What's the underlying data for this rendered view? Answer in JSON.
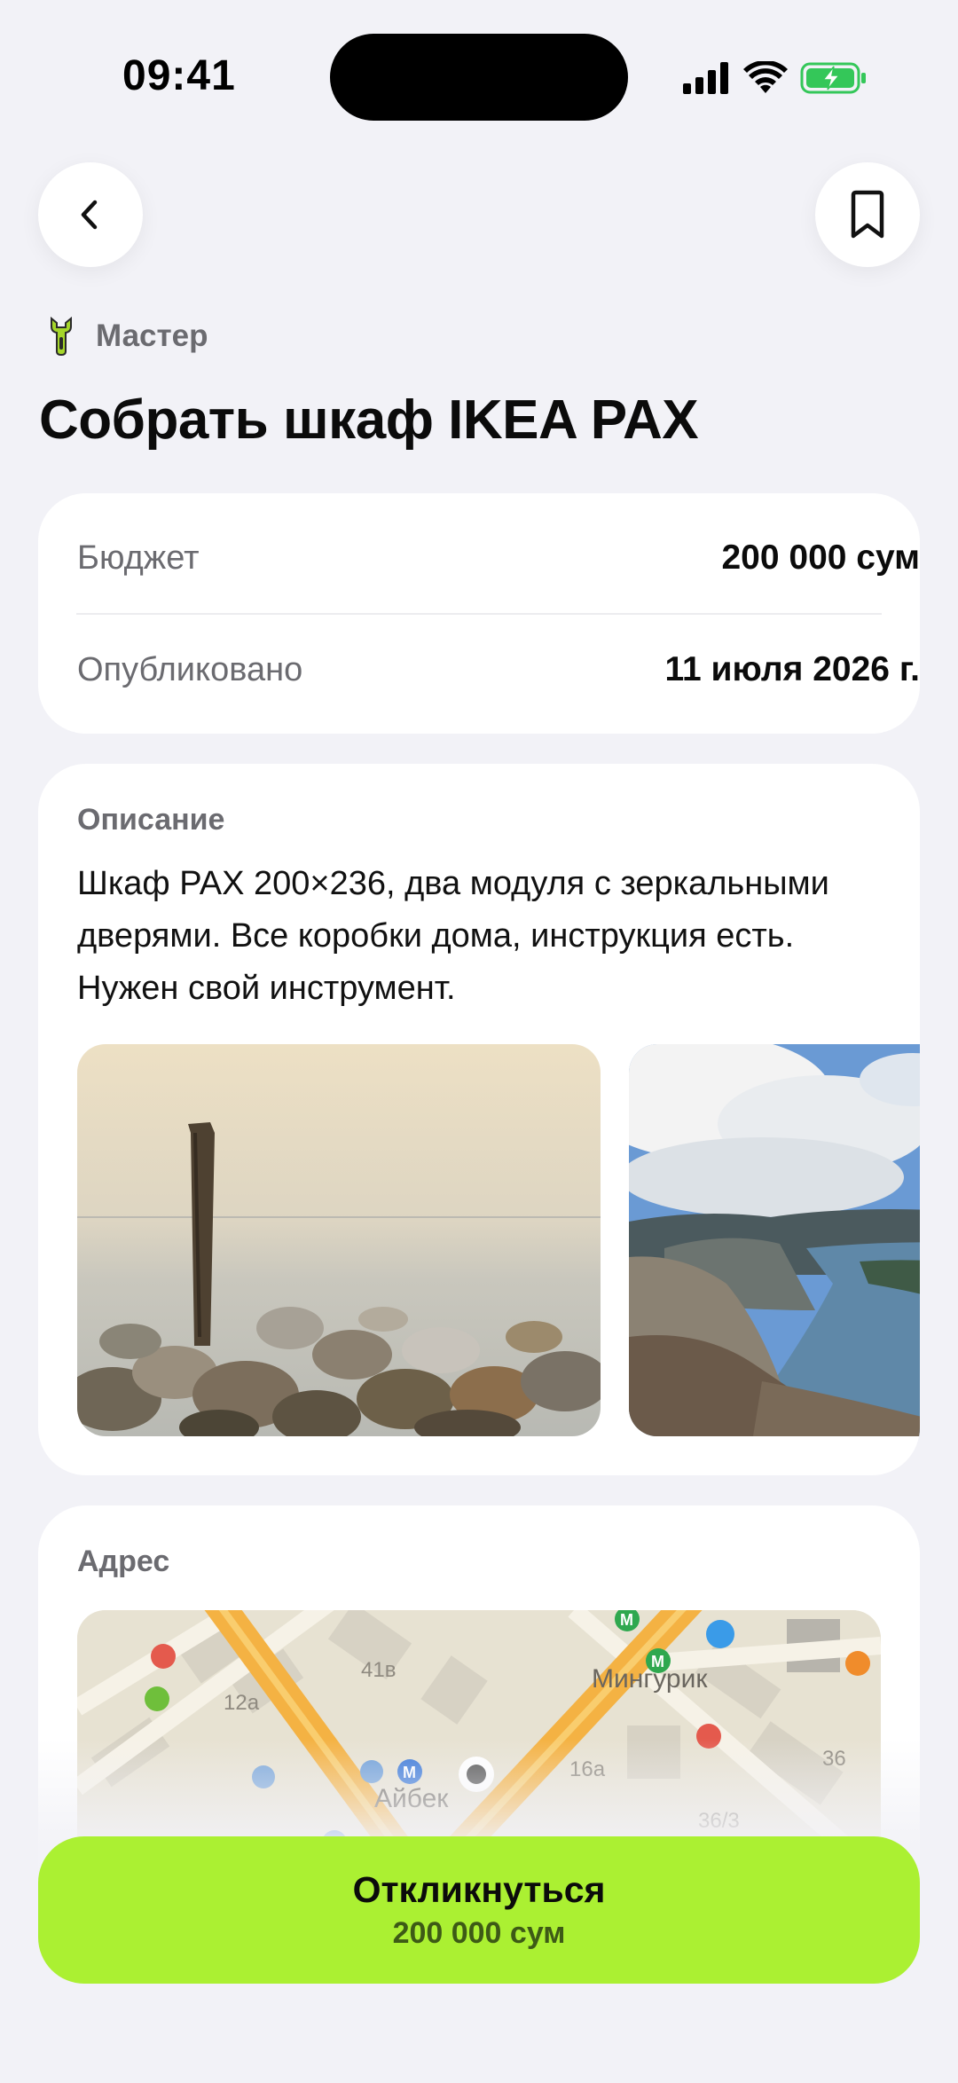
{
  "status_bar": {
    "time": "09:41"
  },
  "header": {
    "back_icon": "chevron-left-icon",
    "bookmark_icon": "bookmark-icon"
  },
  "category": {
    "icon": "wrench-icon",
    "label": "Мастер",
    "icon_color": "#a5d62a"
  },
  "title": "Собрать шкаф IKEA PAX",
  "info": {
    "budget_label": "Бюджет",
    "budget_value": "200 000 сум",
    "published_label": "Опубликовано",
    "published_value": "11 июля 2026 г."
  },
  "description": {
    "label": "Описание",
    "text": "Шкаф PAX 200×236, два модуля с зеркальными дверями. Все коробки дома, инструкция есть. Нужен свой инструмент.",
    "photos": [
      "photo-pole-stones",
      "photo-fjord"
    ]
  },
  "address": {
    "label": "Адрес",
    "map_labels": [
      "41в",
      "12а",
      "Мингурик",
      "16а",
      "Айбек",
      "36",
      "36/3"
    ]
  },
  "cta": {
    "label": "Откликнуться",
    "price": "200 000 сум",
    "color": "#abf032"
  }
}
